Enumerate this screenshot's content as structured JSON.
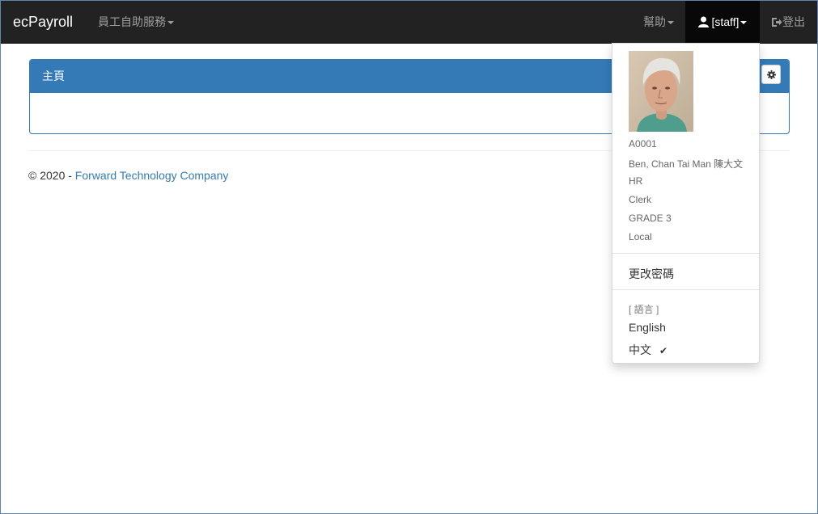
{
  "nav": {
    "brand": "ecPayroll",
    "services": "員工自助服務",
    "help": "幫助",
    "user": "[staff]",
    "logout": "登出"
  },
  "panel": {
    "title": "主頁"
  },
  "footer": {
    "prefix": "© 2020 - ",
    "company": "Forward Technology Company"
  },
  "dropdown": {
    "staff_id": "A0001",
    "name": "Ben, Chan Tai Man 陳大文",
    "department": "HR",
    "position": "Clerk",
    "grade": "GRADE 3",
    "location": "Local",
    "change_password": "更改密碼",
    "language_header": "[ 語言 ]",
    "languages": [
      "English",
      "中文"
    ],
    "selected_language": "中文"
  },
  "colors": {
    "navbar": "#222222",
    "primary": "#337ab7"
  }
}
